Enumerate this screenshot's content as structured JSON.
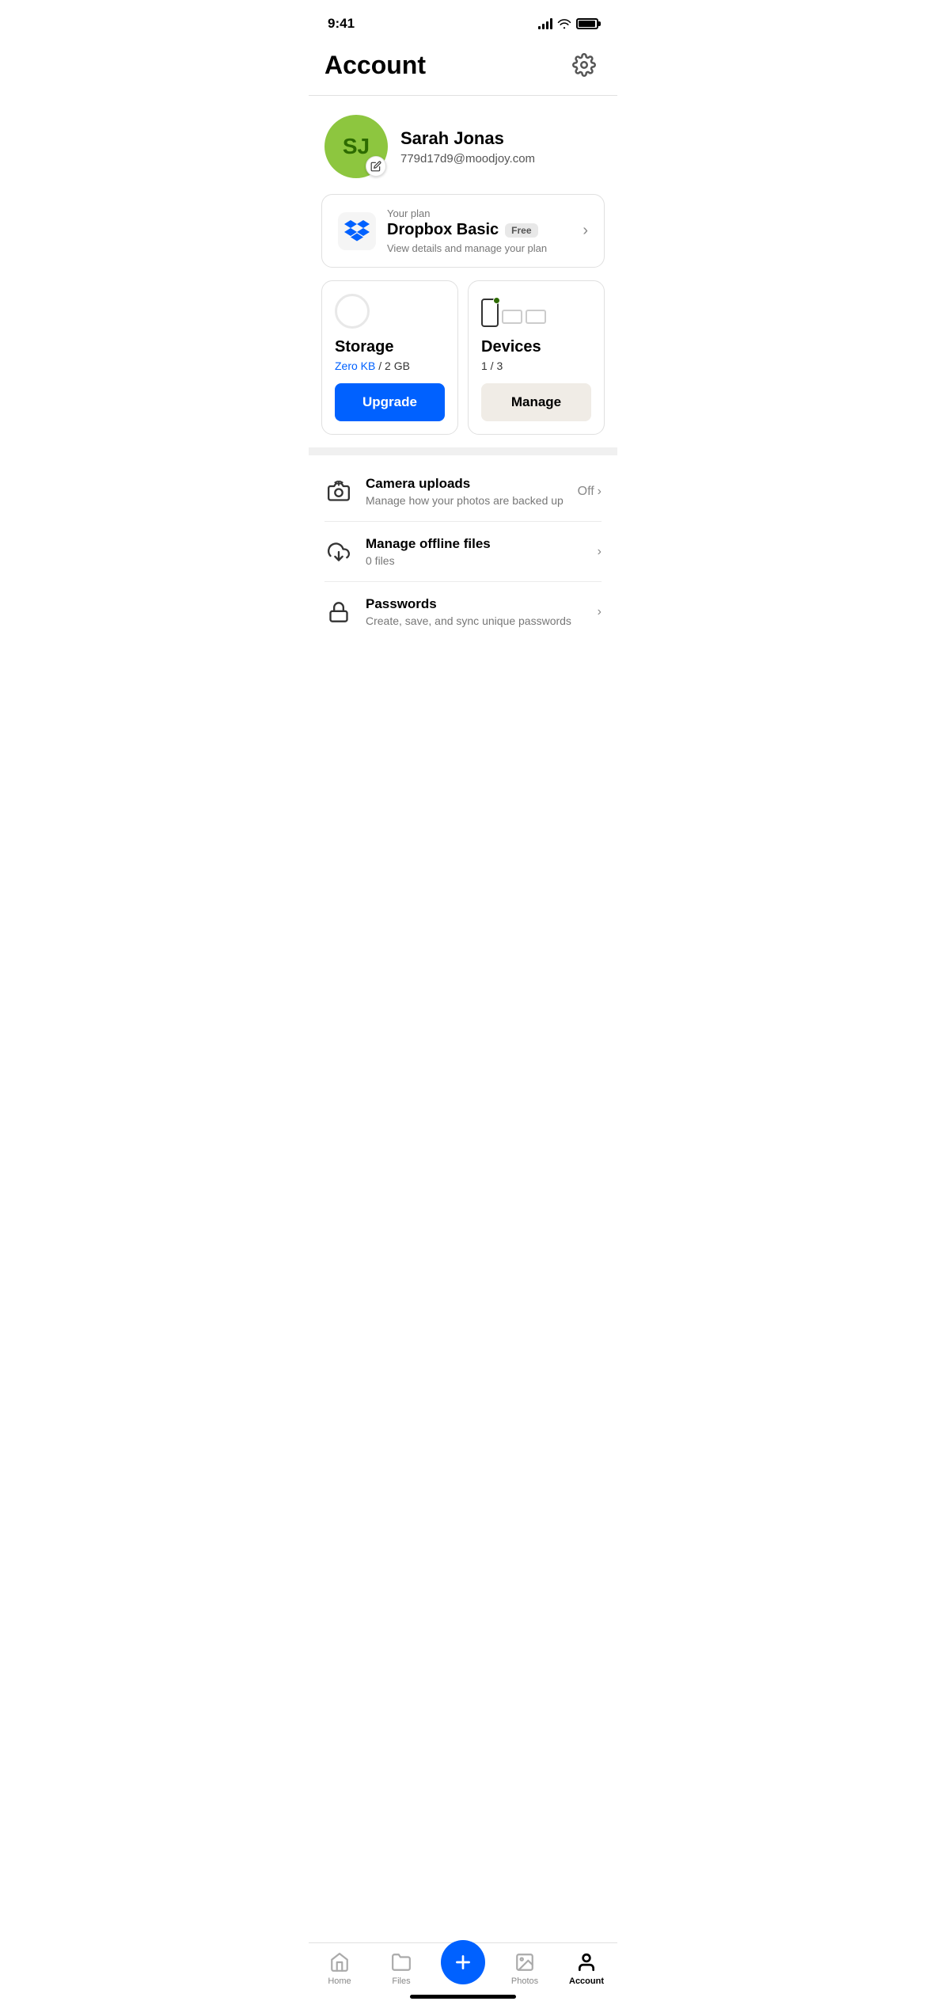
{
  "status": {
    "time": "9:41"
  },
  "header": {
    "title": "Account"
  },
  "profile": {
    "initials": "SJ",
    "name": "Sarah Jonas",
    "email": "779d17d9@moodjoy.com"
  },
  "plan": {
    "label": "Your plan",
    "name": "Dropbox Basic",
    "badge": "Free",
    "description": "View details and manage your plan"
  },
  "storage": {
    "title": "Storage",
    "used": "Zero KB",
    "total": "2 GB",
    "separator": " / ",
    "upgrade_label": "Upgrade"
  },
  "devices": {
    "title": "Devices",
    "count": "1 / 3",
    "manage_label": "Manage"
  },
  "list_items": [
    {
      "id": "camera-uploads",
      "title": "Camera uploads",
      "description": "Manage how your photos are backed up",
      "right_text": "Off",
      "has_chevron": true
    },
    {
      "id": "offline-files",
      "title": "Manage offline files",
      "description": "0 files",
      "right_text": "",
      "has_chevron": true
    },
    {
      "id": "passwords",
      "title": "Passwords",
      "description": "Create, save, and sync unique passwords",
      "right_text": "",
      "has_chevron": true
    }
  ],
  "bottom_nav": {
    "items": [
      {
        "id": "home",
        "label": "Home",
        "active": false
      },
      {
        "id": "files",
        "label": "Files",
        "active": false
      },
      {
        "id": "add",
        "label": "",
        "active": false
      },
      {
        "id": "photos",
        "label": "Photos",
        "active": false
      },
      {
        "id": "account",
        "label": "Account",
        "active": true
      }
    ]
  }
}
